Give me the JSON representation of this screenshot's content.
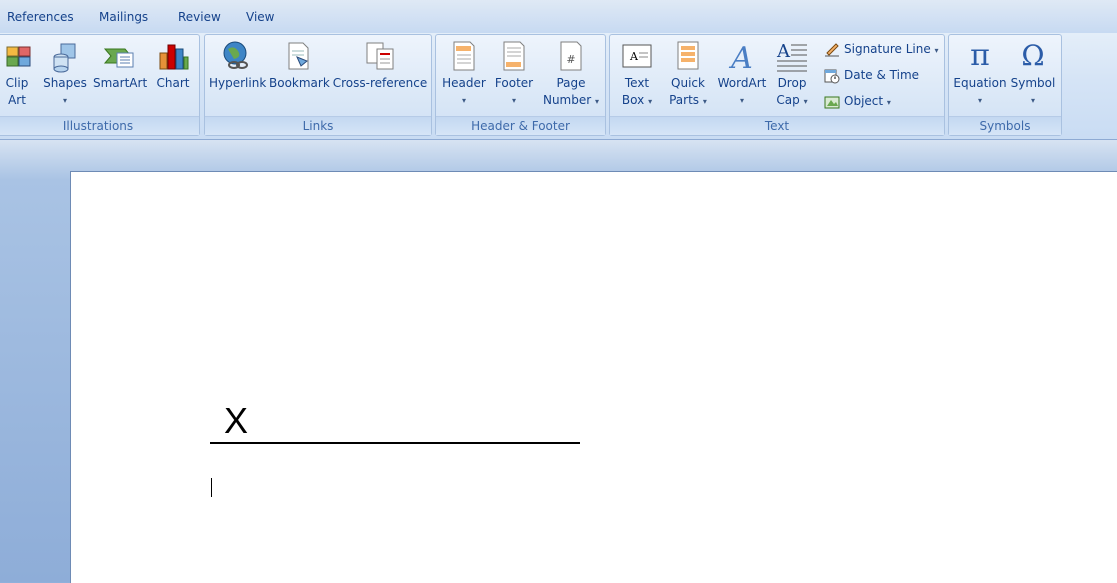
{
  "tabs": [
    "References",
    "Mailings",
    "Review",
    "View"
  ],
  "groups": {
    "illustrations": {
      "label": "Illustrations",
      "clip_art": [
        "Clip",
        "Art"
      ],
      "shapes": "Shapes",
      "smartart": "SmartArt",
      "chart": "Chart"
    },
    "links": {
      "label": "Links",
      "hyperlink": "Hyperlink",
      "bookmark": "Bookmark",
      "cross_reference": "Cross-reference"
    },
    "header_footer": {
      "label": "Header & Footer",
      "header": "Header",
      "footer": "Footer",
      "page_number": [
        "Page",
        "Number"
      ]
    },
    "text": {
      "label": "Text",
      "text_box": [
        "Text",
        "Box"
      ],
      "quick_parts": [
        "Quick",
        "Parts"
      ],
      "wordart": "WordArt",
      "drop_cap": [
        "Drop",
        "Cap"
      ],
      "signature_line": "Signature Line",
      "date_time": "Date & Time",
      "object": "Object"
    },
    "symbols": {
      "label": "Symbols",
      "equation": "Equation",
      "symbol": "Symbol",
      "pi_glyph": "π",
      "omega_glyph": "Ω"
    }
  },
  "document": {
    "signature_mark": "X"
  },
  "caret_glyph": "▾"
}
